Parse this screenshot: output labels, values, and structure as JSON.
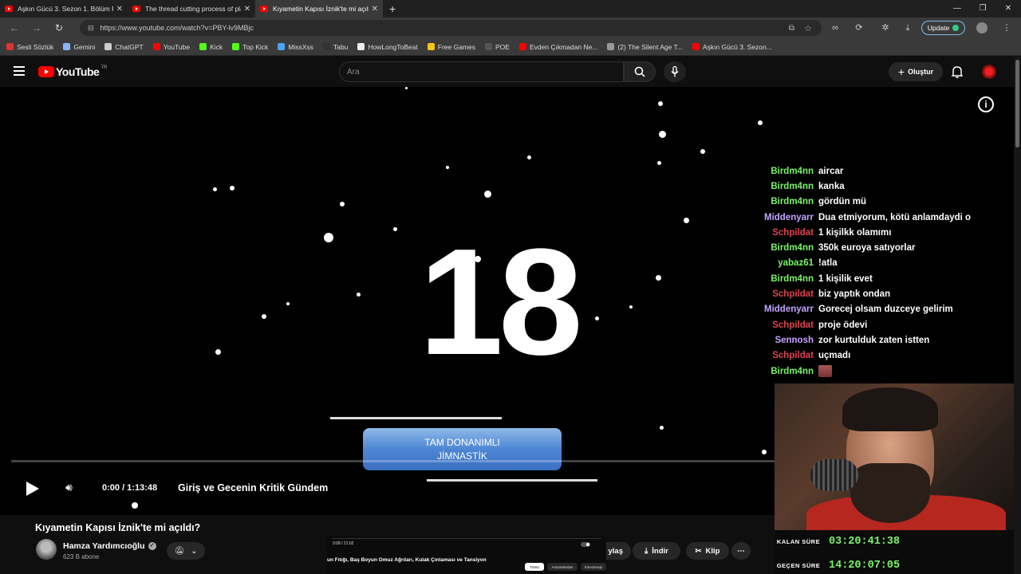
{
  "browser": {
    "tabs": [
      {
        "title": "Aşkın Gücü 3. Sezon 1. Bölüm FUL",
        "active": false
      },
      {
        "title": "The thread cutting process of pla",
        "active": false
      },
      {
        "title": "Kıyametin Kapısı İznik'te mi açıldı",
        "active": true
      }
    ],
    "url": "https://www.youtube.com/watch?v=PBY-lv9MBjc",
    "update_label": "Update",
    "bookmarks": [
      {
        "label": "Sesli Sözlük",
        "color": "#d33"
      },
      {
        "label": "Gemini",
        "color": "#8ab4f8"
      },
      {
        "label": "ChatGPT",
        "color": "#ccc"
      },
      {
        "label": "YouTube",
        "color": "#f00"
      },
      {
        "label": "Kick",
        "color": "#53fc18"
      },
      {
        "label": "Top Kick",
        "color": "#53fc18"
      },
      {
        "label": "MissXss",
        "color": "#4aa3ff"
      },
      {
        "label": "Tabu",
        "color": "#333"
      },
      {
        "label": "HowLongToBeat",
        "color": "#eee"
      },
      {
        "label": "Free Games",
        "color": "#f5c518"
      },
      {
        "label": "POE",
        "color": "#555"
      },
      {
        "label": "Evden Çıkmadan Ne...",
        "color": "#f00"
      },
      {
        "label": "(2) The Silent Age T...",
        "color": "#999"
      },
      {
        "label": "Aşkın Gücü 3. Sezon...",
        "color": "#f00"
      }
    ]
  },
  "youtube": {
    "logo_text": "YouTube",
    "region": "TR",
    "search_placeholder": "Ara",
    "create_label": "Oluştur"
  },
  "video": {
    "big_number": "18",
    "pill_line1": "TAM DONANIMLI",
    "pill_line2": "JİMNASTİK",
    "time": "0:00 / 1:13:48",
    "chapter": "Giriş ve Gecenin Kritik Gündem"
  },
  "chat": [
    {
      "user": "Birdm4nn",
      "color": "#7cf36a",
      "msg": "aircar"
    },
    {
      "user": "Birdm4nn",
      "color": "#7cf36a",
      "msg": "kanka"
    },
    {
      "user": "Birdm4nn",
      "color": "#7cf36a",
      "msg": "gördün mü"
    },
    {
      "user": "Middenyarr",
      "color": "#c3a3ff",
      "msg": "Dua etmiyorum, kötü anlamdaydi o"
    },
    {
      "user": "Schpildat",
      "color": "#e0434f",
      "msg": "1 kişilkk olamımı"
    },
    {
      "user": "Birdm4nn",
      "color": "#7cf36a",
      "msg": "350k euroya satıyorlar"
    },
    {
      "user": "yabaz61",
      "color": "#7cf36a",
      "msg": "!atla"
    },
    {
      "user": "Birdm4nn",
      "color": "#7cf36a",
      "msg": "1 kişilik evet"
    },
    {
      "user": "Schpildat",
      "color": "#e0434f",
      "msg": "biz yaptık ondan"
    },
    {
      "user": "Middenyarr",
      "color": "#c3a3ff",
      "msg": "Gorecej olsam duzceye gelirim"
    },
    {
      "user": "Schpildat",
      "color": "#e0434f",
      "msg": "proje ödevi"
    },
    {
      "user": "Sennosh",
      "color": "#c3a3ff",
      "msg": "zor kurtulduk zaten istten"
    },
    {
      "user": "Schpildat",
      "color": "#e0434f",
      "msg": "uçmadı"
    },
    {
      "user": "Birdm4nn",
      "color": "#7cf36a",
      "msg": ""
    }
  ],
  "timers": {
    "remaining_label": "KALAN SÜRE",
    "remaining_value": "03:20:41:38",
    "elapsed_label": "GEÇEN SÜRE",
    "elapsed_value": "14:20:07:05"
  },
  "details": {
    "title": "Kıyametin Kapısı İznik'te mi açıldı?",
    "channel": "Hamza Yardımcıoğlu",
    "subscribers": "623 B abone",
    "share_label": "ylaş",
    "download_label": "İndir",
    "clip_label": "Klip"
  },
  "mini": {
    "time": "0:08 / 21:02",
    "title": "un Fıtığı, Baş Boyun Omuz Ağrıları, Kulak Çınlaması ve Tansiyon",
    "chips": [
      "Tümü",
      "Arananlardan",
      "Kinezterapi"
    ]
  }
}
